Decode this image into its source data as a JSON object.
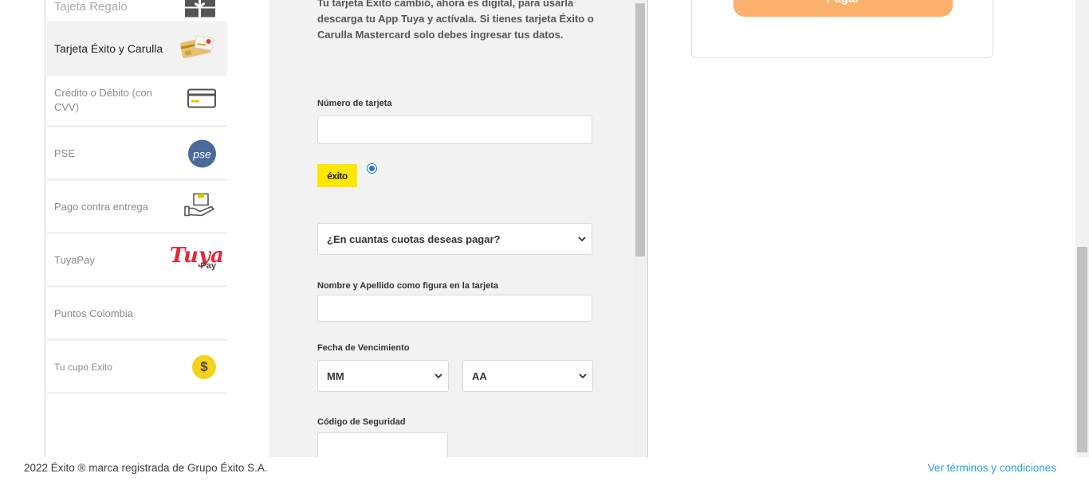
{
  "payment_methods": [
    {
      "label": "Tajeta Regalo",
      "icon": "gift-card-icon"
    },
    {
      "label": "Tarjeta Éxito y Carulla",
      "icon": "exito-carulla-card-icon",
      "selected": true
    },
    {
      "label": "Crédito o Débito (con CVV)",
      "icon": "credit-card-icon"
    },
    {
      "label": "PSE",
      "icon": "pse-logo-icon",
      "logo_text": "pse"
    },
    {
      "label": "Pago contra entrega",
      "icon": "cash-on-delivery-icon"
    },
    {
      "label": "TuyaPay",
      "icon": "tuya-pay-logo-icon",
      "logo_text": "Tuya",
      "logo_subtext": "Pay"
    },
    {
      "label": "Puntos Colombia",
      "icon": ""
    },
    {
      "label": "Tu cupo Exito",
      "icon": "dollar-coin-icon",
      "logo_text": "$"
    }
  ],
  "form": {
    "intro": "Tu tarjeta Éxito cambió, ahora es digital, para usarla descarga tu App Tuya y actívala. Si tienes tarjeta Éxito o Carulla Mastercard solo debes ingresar tus datos.",
    "card_number_label": "Número de tarjeta",
    "card_number_value": "",
    "brand_logo_text": "éxito",
    "installments_placeholder": "¿En cuantas cuotas deseas pagar?",
    "name_label": "Nombre y Apellido como figura en la tarjeta",
    "name_value": "",
    "expiry_label": "Fecha de Vencimiento",
    "month_placeholder": "MM",
    "year_placeholder": "AA",
    "cvv_label": "Código de Seguridad",
    "cvv_value": ""
  },
  "summary": {
    "pay_button": "Pagar"
  },
  "footer": {
    "copyright": "2022 Éxito ® marca registrada de Grupo Éxito S.A.",
    "terms_link": "Ver términos y condiciones"
  },
  "colors": {
    "pay_button": "#fbb06c",
    "link": "#2a9fd6",
    "exito_yellow": "#ffe600",
    "radio_blue": "#1a73e8"
  }
}
